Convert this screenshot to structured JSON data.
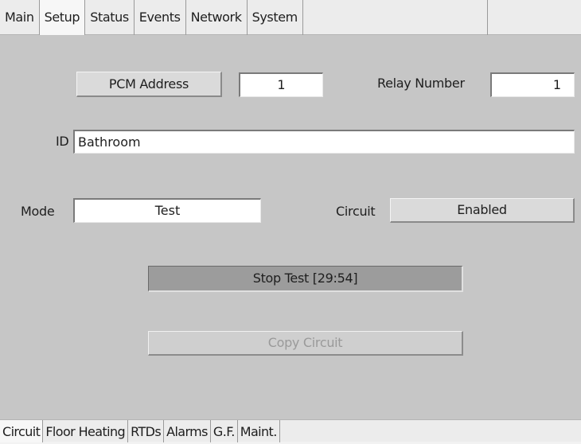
{
  "top_tabs": [
    {
      "label": "Main",
      "active": false
    },
    {
      "label": "Setup",
      "active": true
    },
    {
      "label": "Status",
      "active": false
    },
    {
      "label": "Events",
      "active": false
    },
    {
      "label": "Network",
      "active": false
    },
    {
      "label": "System",
      "active": false
    }
  ],
  "setup": {
    "pcm_address_button": "PCM Address",
    "pcm_address_value": "1",
    "relay_number_label": "Relay Number",
    "relay_number_value": "1",
    "id_label": "ID",
    "id_value": "Bathroom",
    "mode_label": "Mode",
    "mode_value": "Test",
    "circuit_label": "Circuit",
    "circuit_value": "Enabled",
    "stop_test_button": "Stop Test [29:54]",
    "copy_circuit_button": "Copy Circuit"
  },
  "bottom_tabs": [
    {
      "label": "Circuit",
      "active": true
    },
    {
      "label": "Floor Heating",
      "active": false
    },
    {
      "label": "RTDs",
      "active": false
    },
    {
      "label": "Alarms",
      "active": false
    },
    {
      "label": "G.F.",
      "active": false
    },
    {
      "label": "Maint.",
      "active": false
    }
  ],
  "colors": {
    "panel_background": "#c6c6c6",
    "tab_background": "#ececec",
    "active_tab": "#f7f7f7",
    "field_background": "#ffffff",
    "disabled_text": "#9a9a9a"
  }
}
